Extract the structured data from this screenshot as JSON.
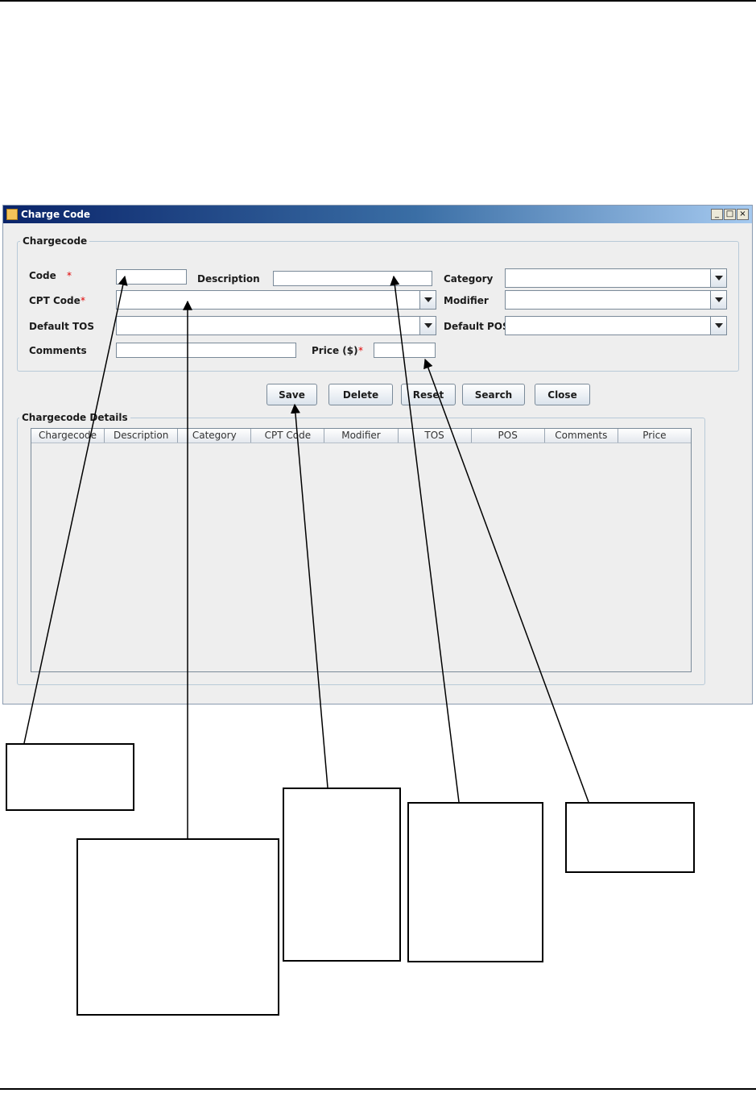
{
  "window": {
    "title": "Charge Code",
    "controls": [
      "_",
      "□",
      "×"
    ]
  },
  "chargecode_group": {
    "title": "Chargecode",
    "fields": {
      "code": {
        "label": "Code",
        "required": "*",
        "value": ""
      },
      "description": {
        "label": "Description",
        "value": ""
      },
      "category": {
        "label": "Category",
        "value": ""
      },
      "cpt_code": {
        "label": "CPT Code",
        "required": "*",
        "value": ""
      },
      "modifier": {
        "label": "Modifier",
        "value": ""
      },
      "default_tos": {
        "label": "Default TOS",
        "value": ""
      },
      "default_pos": {
        "label": "Default POS",
        "value": ""
      },
      "comments": {
        "label": "Comments",
        "value": ""
      },
      "price": {
        "label": "Price ($)",
        "required": "*",
        "value": ""
      }
    }
  },
  "buttons": {
    "save": "Save",
    "delete": "Delete",
    "reset": "Reset",
    "search": "Search",
    "close": "Close"
  },
  "details_group": {
    "title": "Chargecode Details",
    "columns": [
      "Chargecode",
      "Description",
      "Category",
      "CPT Code",
      "Modifier",
      "TOS",
      "POS",
      "Comments",
      "Price"
    ]
  },
  "icons": {
    "app": "java-cup-icon",
    "dropdown": "chevron-down-icon"
  }
}
